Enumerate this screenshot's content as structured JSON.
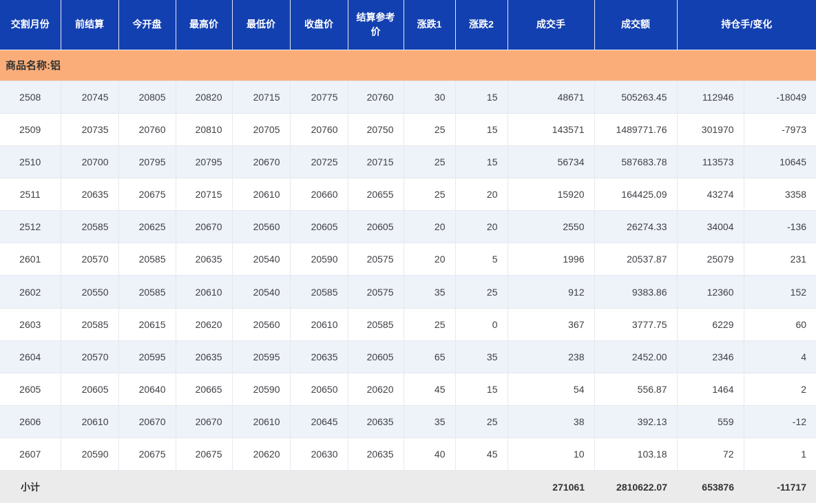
{
  "colors": {
    "header-bg": "#1340b0",
    "header-text": "#ffffff",
    "product-bg": "#fbad79",
    "stripe-bg": "#eef2f9",
    "subtotal-bg": "#ebebeb",
    "text": "#404046"
  },
  "table": {
    "columns": [
      "交割月份",
      "前结算",
      "今开盘",
      "最高价",
      "最低价",
      "收盘价",
      "结算参考价",
      "涨跌1",
      "涨跌2",
      "成交手",
      "成交额",
      "持仓手/变化"
    ],
    "product_label": "商品名称:铝",
    "rows": [
      [
        "2508",
        "20745",
        "20805",
        "20820",
        "20715",
        "20775",
        "20760",
        "30",
        "15",
        "48671",
        "505263.45",
        "112946",
        "-18049"
      ],
      [
        "2509",
        "20735",
        "20760",
        "20810",
        "20705",
        "20760",
        "20750",
        "25",
        "15",
        "143571",
        "1489771.76",
        "301970",
        "-7973"
      ],
      [
        "2510",
        "20700",
        "20795",
        "20795",
        "20670",
        "20725",
        "20715",
        "25",
        "15",
        "56734",
        "587683.78",
        "113573",
        "10645"
      ],
      [
        "2511",
        "20635",
        "20675",
        "20715",
        "20610",
        "20660",
        "20655",
        "25",
        "20",
        "15920",
        "164425.09",
        "43274",
        "3358"
      ],
      [
        "2512",
        "20585",
        "20625",
        "20670",
        "20560",
        "20605",
        "20605",
        "20",
        "20",
        "2550",
        "26274.33",
        "34004",
        "-136"
      ],
      [
        "2601",
        "20570",
        "20585",
        "20635",
        "20540",
        "20590",
        "20575",
        "20",
        "5",
        "1996",
        "20537.87",
        "25079",
        "231"
      ],
      [
        "2602",
        "20550",
        "20585",
        "20610",
        "20540",
        "20585",
        "20575",
        "35",
        "25",
        "912",
        "9383.86",
        "12360",
        "152"
      ],
      [
        "2603",
        "20585",
        "20615",
        "20620",
        "20560",
        "20610",
        "20585",
        "25",
        "0",
        "367",
        "3777.75",
        "6229",
        "60"
      ],
      [
        "2604",
        "20570",
        "20595",
        "20635",
        "20595",
        "20635",
        "20605",
        "65",
        "35",
        "238",
        "2452.00",
        "2346",
        "4"
      ],
      [
        "2605",
        "20605",
        "20640",
        "20665",
        "20590",
        "20650",
        "20620",
        "45",
        "15",
        "54",
        "556.87",
        "1464",
        "2"
      ],
      [
        "2606",
        "20610",
        "20670",
        "20670",
        "20610",
        "20645",
        "20635",
        "35",
        "25",
        "38",
        "392.13",
        "559",
        "-12"
      ],
      [
        "2607",
        "20590",
        "20675",
        "20675",
        "20620",
        "20630",
        "20635",
        "40",
        "45",
        "10",
        "103.18",
        "72",
        "1"
      ]
    ],
    "subtotal_cells": [
      "小计",
      "",
      "",
      "",
      "",
      "",
      "",
      "",
      "",
      "271061",
      "2810622.07",
      "653876",
      "-11717"
    ]
  }
}
